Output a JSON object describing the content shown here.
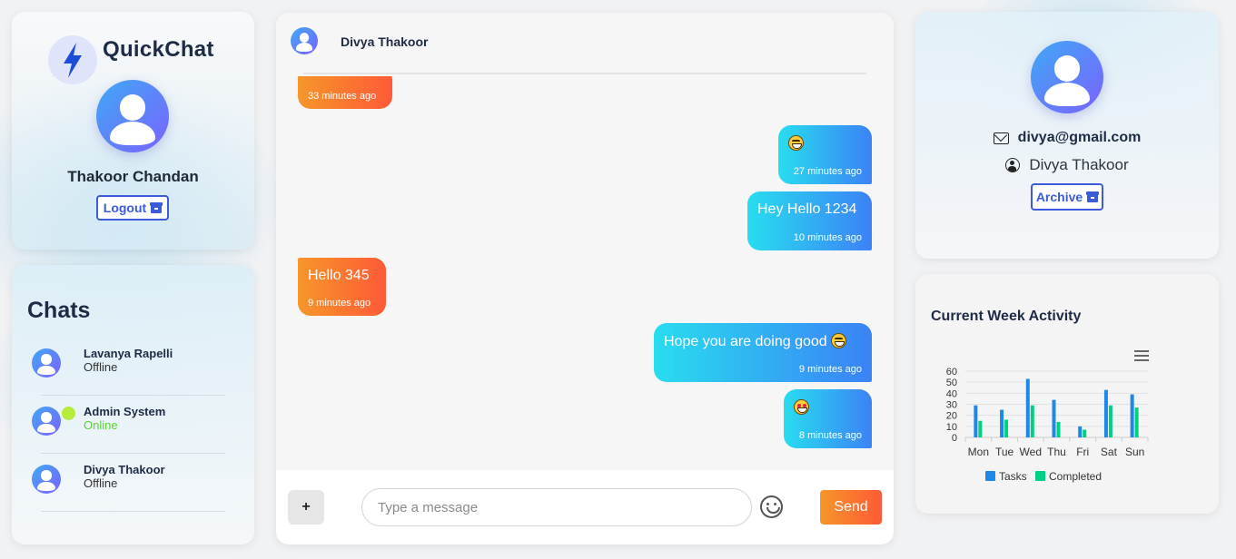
{
  "app": {
    "brand": "QuickChat",
    "current_user": "Thakoor Chandan",
    "logout_label": "Logout"
  },
  "chats": {
    "title": "Chats",
    "items": [
      {
        "name": "Lavanya Rapelli",
        "status": "Offline",
        "online": false
      },
      {
        "name": "Admin System",
        "status": "Online",
        "online": true
      },
      {
        "name": "Divya Thakoor",
        "status": "Offline",
        "online": false
      }
    ]
  },
  "conversation": {
    "contact_name": "Divya Thakoor",
    "messages": [
      {
        "direction": "received",
        "text": "",
        "time": "33 minutes ago"
      },
      {
        "direction": "sent",
        "text": "😆",
        "time": "27 minutes ago"
      },
      {
        "direction": "sent",
        "text": "Hey Hello 1234",
        "time": "10 minutes ago"
      },
      {
        "direction": "received",
        "text": "Hello 345",
        "time": "9 minutes ago"
      },
      {
        "direction": "sent",
        "text": "Hope you are doing good",
        "emoji": "😁",
        "time": "9 minutes ago"
      },
      {
        "direction": "sent",
        "text": "😍",
        "time": "8 minutes ago"
      }
    ],
    "input": {
      "placeholder": "Type a message",
      "value": "",
      "plus_label": "+",
      "send_label": "Send"
    }
  },
  "profile": {
    "email": "divya@gmail.com",
    "name": "Divya Thakoor",
    "archive_label": "Archive"
  },
  "activity": {
    "title": "Current Week Activity"
  },
  "colors": {
    "accent": "#3b5bdb",
    "sent_start": "#28ddef",
    "sent_end": "#3b82f6",
    "recv_start": "#f6962a",
    "recv_end": "#ff5a36",
    "online": "#5ad52b"
  },
  "chart_data": {
    "type": "bar",
    "categories": [
      "Mon",
      "Tue",
      "Wed",
      "Thu",
      "Fri",
      "Sat",
      "Sun"
    ],
    "series": [
      {
        "name": "Tasks",
        "values": [
          29,
          25,
          53,
          34,
          10,
          43,
          39
        ],
        "color": "#1e88e5"
      },
      {
        "name": "Completed",
        "values": [
          15,
          16,
          29,
          14,
          7,
          29,
          27
        ],
        "color": "#00d084"
      }
    ],
    "y_ticks": [
      0,
      10,
      20,
      30,
      40,
      50,
      60
    ],
    "ylim": [
      0,
      60
    ],
    "legend": "bottom",
    "grid": true
  }
}
